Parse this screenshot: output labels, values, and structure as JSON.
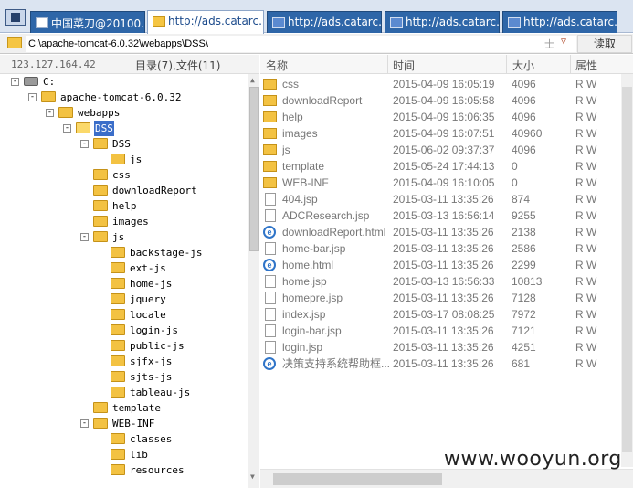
{
  "tabs": [
    {
      "label": "中国菜刀@20100...",
      "icon": "document-icon",
      "active": false
    },
    {
      "label": "http://ads.catarc.i...",
      "icon": "folder-icon",
      "active": true
    },
    {
      "label": "http://ads.catarc.i...",
      "icon": "grid-icon",
      "active": false
    },
    {
      "label": "http://ads.catarc.i...",
      "icon": "grid-icon",
      "active": false
    },
    {
      "label": "http://ads.catarc.i...",
      "icon": "grid-icon",
      "active": false
    }
  ],
  "address": {
    "path": "C:\\apache-tomcat-6.0.32\\webapps\\DSS\\",
    "star": "士",
    "dropdown": "▽",
    "read_button": "读取"
  },
  "left_header": {
    "ip": "123.127.164.42",
    "summary": "目录(7),文件(11)"
  },
  "tree": [
    {
      "label": "C:",
      "depth": 0,
      "box": "-",
      "kind": "drive"
    },
    {
      "label": "apache-tomcat-6.0.32",
      "depth": 1,
      "box": "-",
      "kind": "folder"
    },
    {
      "label": "webapps",
      "depth": 2,
      "box": "-",
      "kind": "folder"
    },
    {
      "label": "DSS",
      "depth": 3,
      "box": "-",
      "kind": "folder-open",
      "selected": true
    },
    {
      "label": "DSS",
      "depth": 4,
      "box": "-",
      "kind": "folder"
    },
    {
      "label": "js",
      "depth": 5,
      "box": "",
      "kind": "folder"
    },
    {
      "label": "css",
      "depth": 4,
      "box": "",
      "kind": "folder"
    },
    {
      "label": "downloadReport",
      "depth": 4,
      "box": "",
      "kind": "folder"
    },
    {
      "label": "help",
      "depth": 4,
      "box": "",
      "kind": "folder"
    },
    {
      "label": "images",
      "depth": 4,
      "box": "",
      "kind": "folder"
    },
    {
      "label": "js",
      "depth": 4,
      "box": "-",
      "kind": "folder"
    },
    {
      "label": "backstage-js",
      "depth": 5,
      "box": "",
      "kind": "folder"
    },
    {
      "label": "ext-js",
      "depth": 5,
      "box": "",
      "kind": "folder"
    },
    {
      "label": "home-js",
      "depth": 5,
      "box": "",
      "kind": "folder"
    },
    {
      "label": "jquery",
      "depth": 5,
      "box": "",
      "kind": "folder"
    },
    {
      "label": "locale",
      "depth": 5,
      "box": "",
      "kind": "folder"
    },
    {
      "label": "login-js",
      "depth": 5,
      "box": "",
      "kind": "folder"
    },
    {
      "label": "public-js",
      "depth": 5,
      "box": "",
      "kind": "folder"
    },
    {
      "label": "sjfx-js",
      "depth": 5,
      "box": "",
      "kind": "folder"
    },
    {
      "label": "sjts-js",
      "depth": 5,
      "box": "",
      "kind": "folder"
    },
    {
      "label": "tableau-js",
      "depth": 5,
      "box": "",
      "kind": "folder"
    },
    {
      "label": "template",
      "depth": 4,
      "box": "",
      "kind": "folder"
    },
    {
      "label": "WEB-INF",
      "depth": 4,
      "box": "-",
      "kind": "folder"
    },
    {
      "label": "classes",
      "depth": 5,
      "box": "",
      "kind": "folder"
    },
    {
      "label": "lib",
      "depth": 5,
      "box": "",
      "kind": "folder"
    },
    {
      "label": "resources",
      "depth": 5,
      "box": "",
      "kind": "folder"
    }
  ],
  "columns": {
    "name": "名称",
    "time": "时间",
    "size": "大小",
    "attr": "属性"
  },
  "files": [
    {
      "name": "css",
      "time": "2015-04-09 16:05:19",
      "size": "4096",
      "attr": "R W",
      "type": "folder"
    },
    {
      "name": "downloadReport",
      "time": "2015-04-09 16:05:58",
      "size": "4096",
      "attr": "R W",
      "type": "folder"
    },
    {
      "name": "help",
      "time": "2015-04-09 16:06:35",
      "size": "4096",
      "attr": "R W",
      "type": "folder"
    },
    {
      "name": "images",
      "time": "2015-04-09 16:07:51",
      "size": "40960",
      "attr": "R W",
      "type": "folder"
    },
    {
      "name": "js",
      "time": "2015-06-02 09:37:37",
      "size": "4096",
      "attr": "R W",
      "type": "folder"
    },
    {
      "name": "template",
      "time": "2015-05-24 17:44:13",
      "size": "0",
      "attr": "R W",
      "type": "folder"
    },
    {
      "name": "WEB-INF",
      "time": "2015-04-09 16:10:05",
      "size": "0",
      "attr": "R W",
      "type": "folder"
    },
    {
      "name": "404.jsp",
      "time": "2015-03-11 13:35:26",
      "size": "874",
      "attr": "R W",
      "type": "file"
    },
    {
      "name": "ADCResearch.jsp",
      "time": "2015-03-13 16:56:14",
      "size": "9255",
      "attr": "R W",
      "type": "file"
    },
    {
      "name": "downloadReport.html",
      "time": "2015-03-11 13:35:26",
      "size": "2138",
      "attr": "R W",
      "type": "html"
    },
    {
      "name": "home-bar.jsp",
      "time": "2015-03-11 13:35:26",
      "size": "2586",
      "attr": "R W",
      "type": "file"
    },
    {
      "name": "home.html",
      "time": "2015-03-11 13:35:26",
      "size": "2299",
      "attr": "R W",
      "type": "html"
    },
    {
      "name": "home.jsp",
      "time": "2015-03-13 16:56:33",
      "size": "10813",
      "attr": "R W",
      "type": "file"
    },
    {
      "name": "homepre.jsp",
      "time": "2015-03-11 13:35:26",
      "size": "7128",
      "attr": "R W",
      "type": "file"
    },
    {
      "name": "index.jsp",
      "time": "2015-03-17 08:08:25",
      "size": "7972",
      "attr": "R W",
      "type": "file"
    },
    {
      "name": "login-bar.jsp",
      "time": "2015-03-11 13:35:26",
      "size": "7121",
      "attr": "R W",
      "type": "file"
    },
    {
      "name": "login.jsp",
      "time": "2015-03-11 13:35:26",
      "size": "4251",
      "attr": "R W",
      "type": "file"
    },
    {
      "name": "决策支持系统帮助框...",
      "time": "2015-03-11 13:35:26",
      "size": "681",
      "attr": "R W",
      "type": "html"
    }
  ],
  "watermark": "www.wooyun.org",
  "colors": {
    "tab_blue": "#2e66a8",
    "selection": "#3b6ec9",
    "folder": "#f3c242"
  }
}
